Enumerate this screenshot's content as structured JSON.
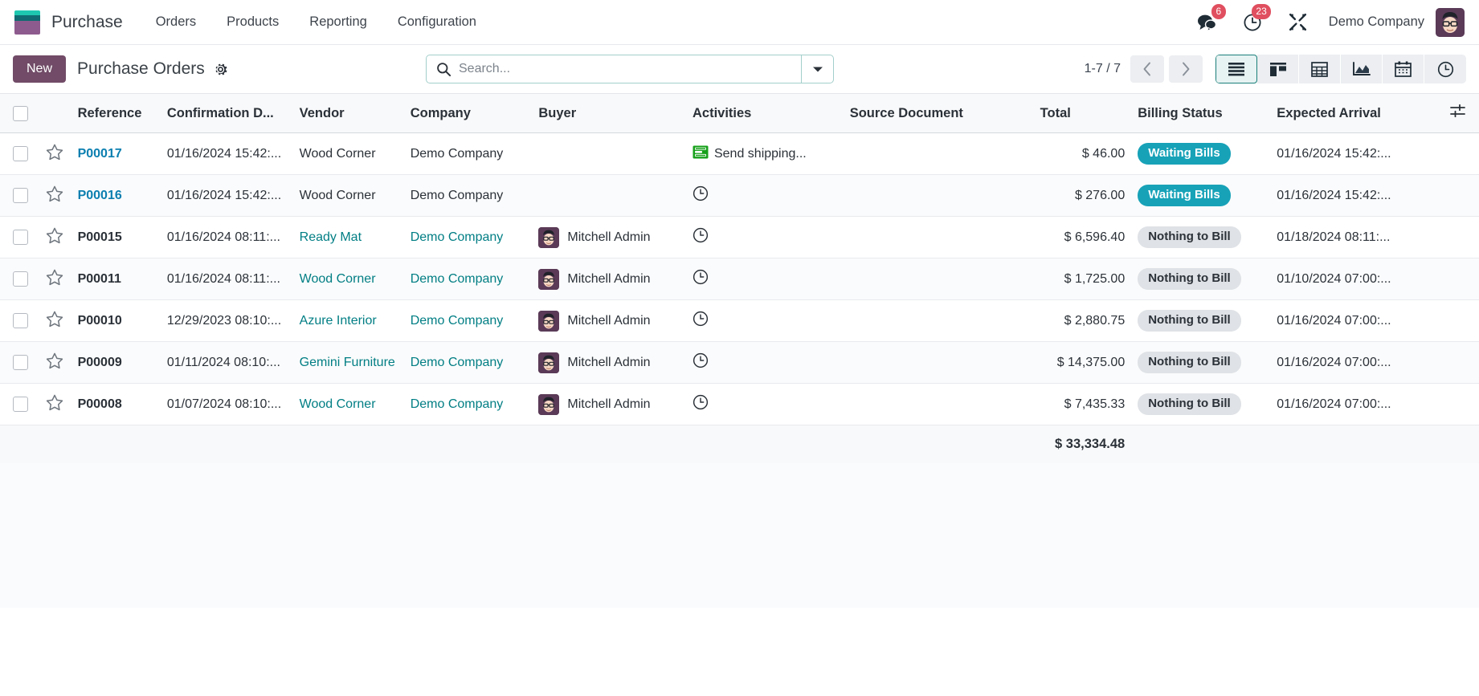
{
  "navbar": {
    "logo_icon": "purchase-app-logo",
    "brand": "Purchase",
    "menu": [
      {
        "label": "Orders"
      },
      {
        "label": "Products"
      },
      {
        "label": "Reporting"
      },
      {
        "label": "Configuration"
      }
    ],
    "messages_icon": "messages-icon",
    "messages_count": "6",
    "activities_icon": "clock-activities-icon",
    "activities_count": "23",
    "tools_icon": "developer-tools-icon",
    "company": "Demo Company",
    "avatar_icon": "user-avatar"
  },
  "control": {
    "new_label": "New",
    "title": "Purchase Orders",
    "gear_icon": "gear-icon",
    "search_icon": "search-icon",
    "search_value": "",
    "search_placeholder": "Search...",
    "dropdown_icon": "chevron-down-icon",
    "pager": "1-7 / 7",
    "prev_icon": "chevron-left-icon",
    "next_icon": "chevron-right-icon",
    "views": [
      {
        "name": "list-view",
        "icon": "list-icon",
        "active": true
      },
      {
        "name": "kanban-view",
        "icon": "kanban-icon",
        "active": false
      },
      {
        "name": "pivot-view",
        "icon": "pivot-table-icon",
        "active": false
      },
      {
        "name": "graph-view",
        "icon": "area-chart-icon",
        "active": false
      },
      {
        "name": "calendar-view",
        "icon": "calendar-icon",
        "active": false
      },
      {
        "name": "activity-view",
        "icon": "clock-icon",
        "active": false
      }
    ]
  },
  "table": {
    "headers": {
      "reference": "Reference",
      "confirmation_date": "Confirmation D...",
      "vendor": "Vendor",
      "company": "Company",
      "buyer": "Buyer",
      "activities": "Activities",
      "source_document": "Source Document",
      "total": "Total",
      "billing_status": "Billing Status",
      "expected_arrival": "Expected Arrival",
      "optional_icon": "column-options-icon"
    },
    "rows": [
      {
        "reference": "P00017",
        "confirmation_date": "01/16/2024 15:42:...",
        "vendor": "Wood Corner",
        "company": "Demo Company",
        "buyer": "",
        "activity_label": "Send shipping...",
        "activity_icon": "send-email-icon",
        "source_document": "",
        "total": "$ 46.00",
        "billing_status": "Waiting Bills",
        "billing_style": "waiting",
        "expected_arrival": "01/16/2024 15:42:...",
        "unbilled": true
      },
      {
        "reference": "P00016",
        "confirmation_date": "01/16/2024 15:42:...",
        "vendor": "Wood Corner",
        "company": "Demo Company",
        "buyer": "",
        "activity_label": "",
        "activity_icon": "clock-icon",
        "source_document": "",
        "total": "$ 276.00",
        "billing_status": "Waiting Bills",
        "billing_style": "waiting",
        "expected_arrival": "01/16/2024 15:42:...",
        "unbilled": true
      },
      {
        "reference": "P00015",
        "confirmation_date": "01/16/2024 08:11:...",
        "vendor": "Ready Mat",
        "company": "Demo Company",
        "buyer": "Mitchell Admin",
        "activity_label": "",
        "activity_icon": "clock-icon",
        "source_document": "",
        "total": "$ 6,596.40",
        "billing_status": "Nothing to Bill",
        "billing_style": "nothing",
        "expected_arrival": "01/18/2024 08:11:...",
        "unbilled": false
      },
      {
        "reference": "P00011",
        "confirmation_date": "01/16/2024 08:11:...",
        "vendor": "Wood Corner",
        "company": "Demo Company",
        "buyer": "Mitchell Admin",
        "activity_label": "",
        "activity_icon": "clock-icon",
        "source_document": "",
        "total": "$ 1,725.00",
        "billing_status": "Nothing to Bill",
        "billing_style": "nothing",
        "expected_arrival": "01/10/2024 07:00:...",
        "unbilled": false
      },
      {
        "reference": "P00010",
        "confirmation_date": "12/29/2023 08:10:...",
        "vendor": "Azure Interior",
        "company": "Demo Company",
        "buyer": "Mitchell Admin",
        "activity_label": "",
        "activity_icon": "clock-icon",
        "source_document": "",
        "total": "$ 2,880.75",
        "billing_status": "Nothing to Bill",
        "billing_style": "nothing",
        "expected_arrival": "01/16/2024 07:00:...",
        "unbilled": false
      },
      {
        "reference": "P00009",
        "confirmation_date": "01/11/2024 08:10:...",
        "vendor": "Gemini Furniture",
        "company": "Demo Company",
        "buyer": "Mitchell Admin",
        "activity_label": "",
        "activity_icon": "clock-icon",
        "source_document": "",
        "total": "$ 14,375.00",
        "billing_status": "Nothing to Bill",
        "billing_style": "nothing",
        "expected_arrival": "01/16/2024 07:00:...",
        "unbilled": false
      },
      {
        "reference": "P00008",
        "confirmation_date": "01/07/2024 08:10:...",
        "vendor": "Wood Corner",
        "company": "Demo Company",
        "buyer": "Mitchell Admin",
        "activity_label": "",
        "activity_icon": "clock-icon",
        "source_document": "",
        "total": "$ 7,435.33",
        "billing_status": "Nothing to Bill",
        "billing_style": "nothing",
        "expected_arrival": "01/16/2024 07:00:...",
        "unbilled": false
      }
    ],
    "footer_total": "$ 33,334.48"
  },
  "colors": {
    "brand_purple": "#714b67",
    "accent_teal": "#017e84",
    "badge_waiting": "#17a2b8",
    "badge_nothing": "#dfe2e6",
    "link_blue": "#0b7fb0",
    "notification_red": "#e04f5f"
  }
}
